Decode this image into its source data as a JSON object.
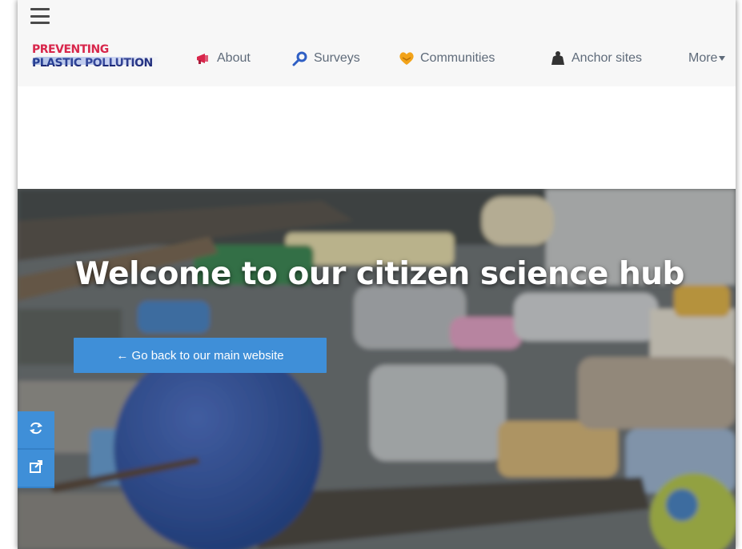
{
  "topbar": {
    "menu_icon": "hamburger-menu-icon"
  },
  "brand": {
    "line1": "PREVENTING",
    "line2": "PLASTIC POLLUTION",
    "colors": {
      "accent": "#d8264b",
      "navy": "#1e2a78"
    }
  },
  "nav": {
    "items": [
      {
        "label": "About",
        "icon": "megaphone-icon"
      },
      {
        "label": "Surveys",
        "icon": "magnifier-icon"
      },
      {
        "label": "Communities",
        "icon": "heart-handshake-icon"
      },
      {
        "label": "Anchor sites",
        "icon": "anchor-icon"
      },
      {
        "label": "More",
        "icon": "caret-down-icon"
      }
    ]
  },
  "hero": {
    "title": "Welcome to our citizen science hub",
    "back_button": "← Go back to our main website",
    "button_color": "#3f8fd8"
  },
  "side_tools": [
    {
      "icon": "refresh-icon"
    },
    {
      "icon": "share-icon"
    }
  ]
}
